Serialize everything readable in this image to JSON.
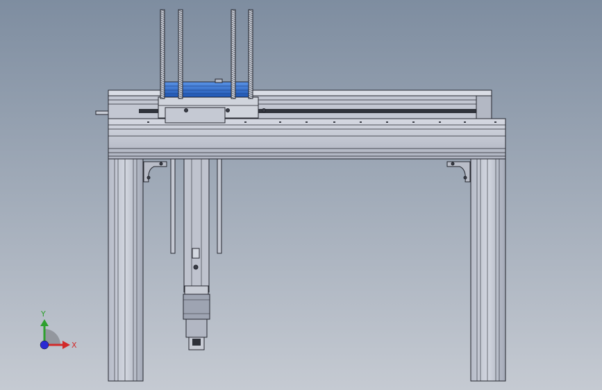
{
  "viewport": {
    "background_top": "#7e8da0",
    "background_bottom": "#c5cad2"
  },
  "model": {
    "steel_light": "#c8ccd7",
    "steel_mid": "#a8aebc",
    "steel_dark": "#6a7080",
    "outline": "#23252d",
    "accent_blue": "#2f6fd0"
  },
  "triad": {
    "y_label": "Y",
    "x_label": "X",
    "y_color": "#2ea02e",
    "x_color": "#d22a2a",
    "z_color": "#2a2ad2"
  }
}
